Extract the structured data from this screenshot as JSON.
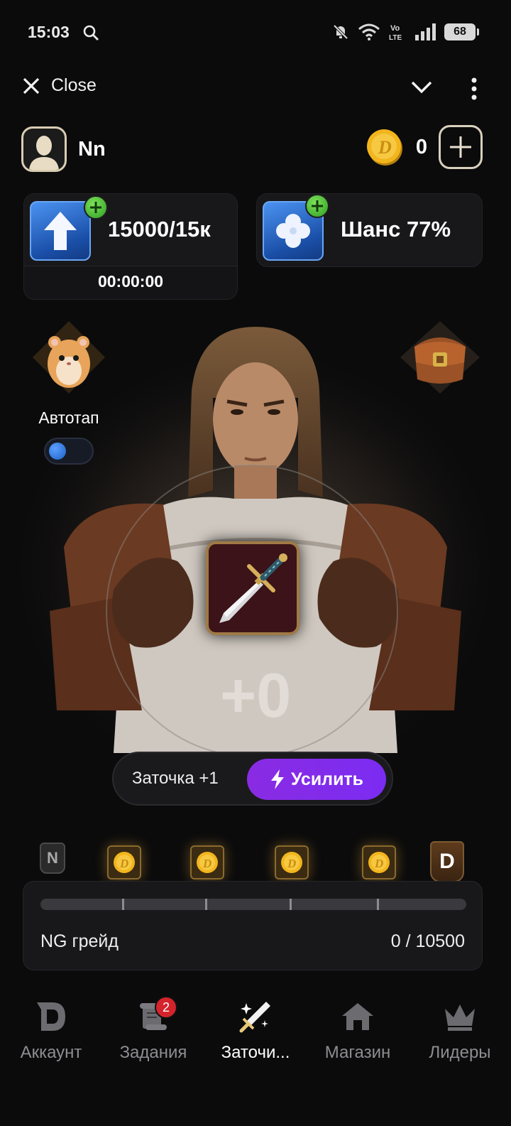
{
  "status": {
    "time": "15:03",
    "battery": "68"
  },
  "topbar": {
    "close_label": "Close"
  },
  "profile": {
    "username": "Nn"
  },
  "balance": {
    "coins": "0"
  },
  "energy": {
    "value": "15000/15к",
    "timer": "00:00:00"
  },
  "chance": {
    "value": "Шанс 77%"
  },
  "autotap": {
    "label": "Автотап",
    "enabled": false
  },
  "item": {
    "level": "+0"
  },
  "enhance": {
    "info": "Заточка +1",
    "button_label": "Усилить"
  },
  "grade": {
    "label": "NG грейд",
    "progress_text": "0 / 10500",
    "progress": 0,
    "start_grade": "N",
    "end_grade": "D"
  },
  "tabs": [
    {
      "label": "Аккаунт",
      "icon": "d-logo-icon"
    },
    {
      "label": "Задания",
      "icon": "scroll-icon",
      "badge": "2"
    },
    {
      "label": "Заточи...",
      "icon": "sword-sparkle-icon",
      "active": true
    },
    {
      "label": "Магазин",
      "icon": "shop-icon"
    },
    {
      "label": "Лидеры",
      "icon": "crown-icon"
    }
  ],
  "colors": {
    "accent": "#8a2be2",
    "background": "#0b0b0c",
    "coin": "#f2b51c"
  }
}
